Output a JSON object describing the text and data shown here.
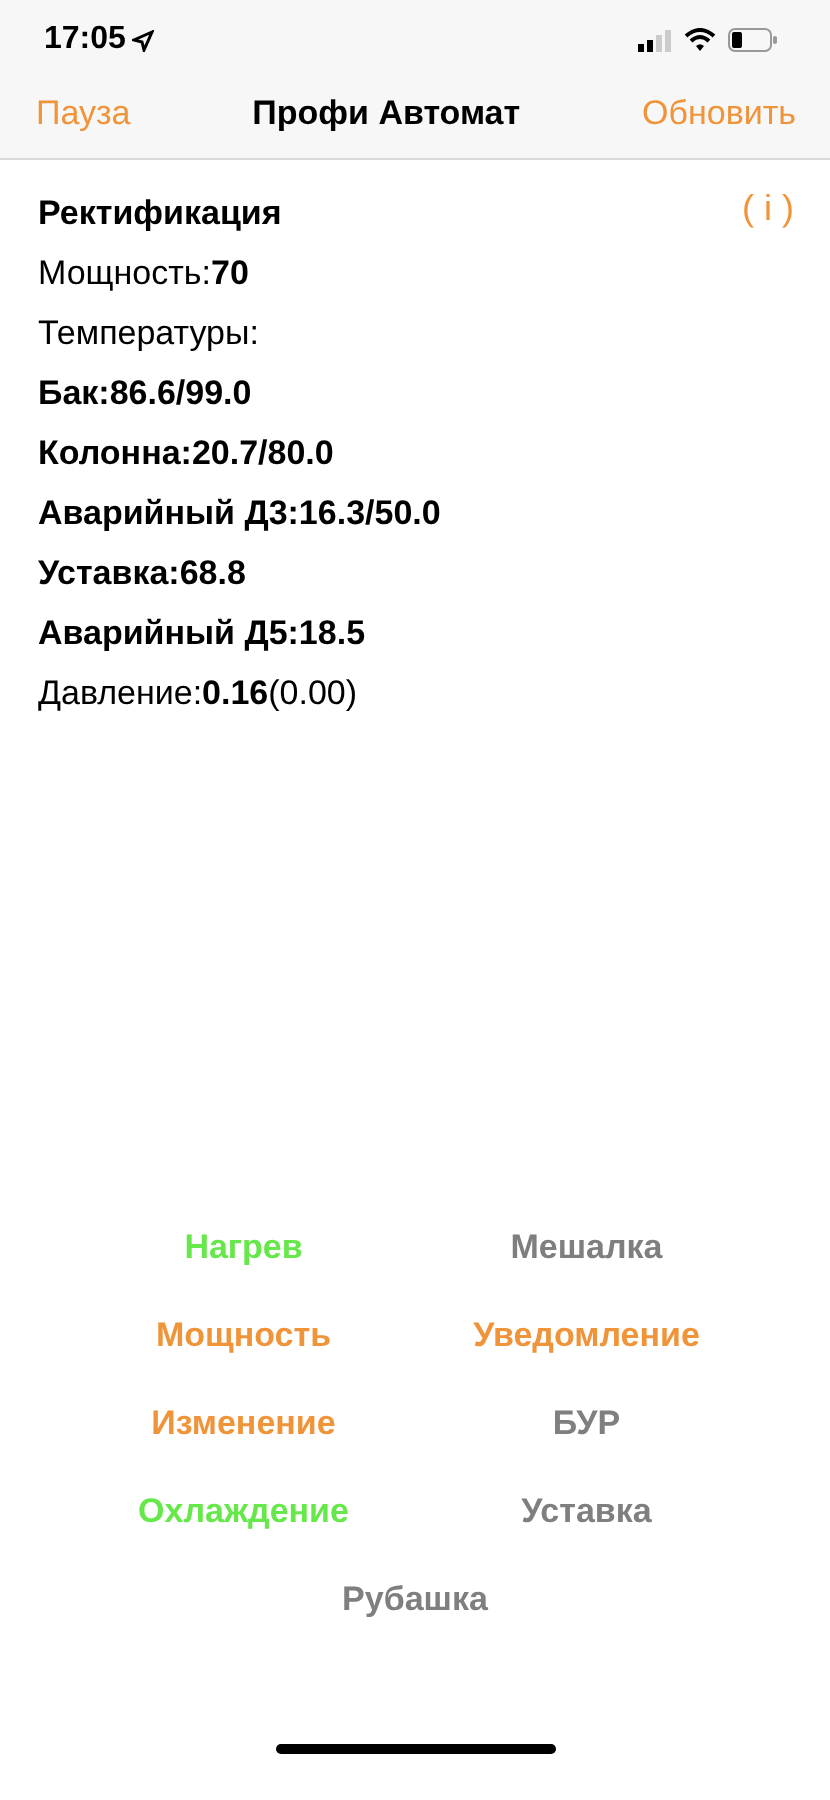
{
  "status_bar": {
    "time": "17:05"
  },
  "nav": {
    "left": "Пауза",
    "title": "Профи Автомат",
    "right": "Обновить"
  },
  "info_button": "( i )",
  "lines": [
    {
      "text": "Ректификация",
      "bold": true
    },
    {
      "text": "Мощность:**70**",
      "bold": false
    },
    {
      "text": "Температуры:",
      "bold": false
    },
    {
      "text": "Бак:86.6/99.0",
      "bold": true
    },
    {
      "text": "Колонна:20.7/80.0",
      "bold": true
    },
    {
      "text": "Аварийный Д3:16.3/50.0",
      "bold": true
    },
    {
      "text": "Уставка:68.8",
      "bold": true
    },
    {
      "text": "Аварийный Д5:18.5",
      "bold": true
    },
    {
      "text": "Давление:**0.16**(0.00)",
      "bold": false
    }
  ],
  "buttons": [
    {
      "label": "Нагрев",
      "color": "#66e84a"
    },
    {
      "label": "Мешалка",
      "color": "#7f7f7f"
    },
    {
      "label": "Мощность",
      "color": "#f0943a"
    },
    {
      "label": "Уведомление",
      "color": "#f0943a"
    },
    {
      "label": "Изменение",
      "color": "#f0943a"
    },
    {
      "label": "БУР",
      "color": "#7f7f7f"
    },
    {
      "label": "Охлаждение",
      "color": "#66e84a"
    },
    {
      "label": "Уставка",
      "color": "#7f7f7f"
    },
    {
      "label": "Рубашка",
      "color": "#7f7f7f"
    }
  ]
}
